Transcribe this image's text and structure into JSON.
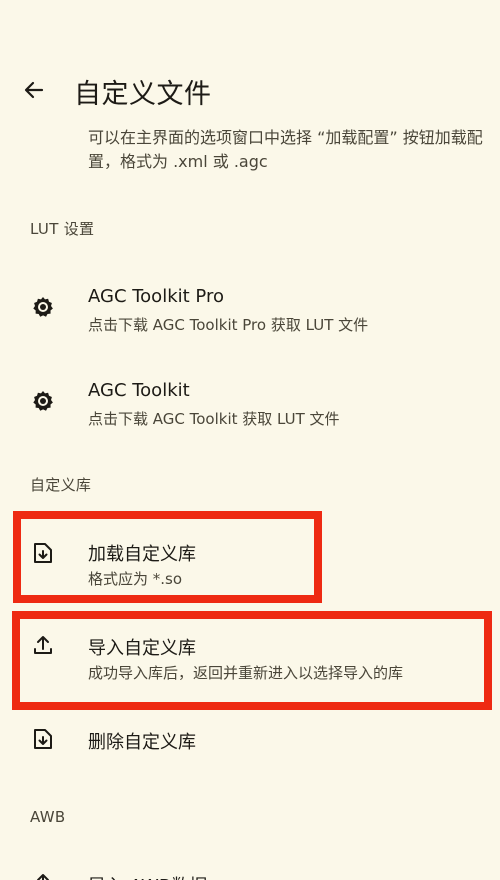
{
  "header": {
    "title": "自定义文件",
    "description": "可以在主界面的选项窗口中选择 “加载配置” 按钮加载配置，格式为 .xml 或 .agc"
  },
  "sections": {
    "lut": {
      "header": "LUT 设置",
      "items": [
        {
          "label": "AGC Toolkit Pro",
          "sub": "点击下载 AGC Toolkit Pro 获取 LUT 文件",
          "icon": "gear-icon"
        },
        {
          "label": "AGC Toolkit",
          "sub": "点击下载 AGC Toolkit 获取 LUT 文件",
          "icon": "gear-icon"
        }
      ]
    },
    "library": {
      "header": "自定义库",
      "items": [
        {
          "label": "加载自定义库",
          "sub": "格式应为 *.so",
          "icon": "file-download-icon"
        },
        {
          "label": "导入自定义库",
          "sub": "成功导入库后，返回并重新进入以选择导入的库",
          "icon": "upload-icon"
        },
        {
          "label": "删除自定义库",
          "icon": "file-download-icon"
        }
      ]
    },
    "awb": {
      "header": "AWB",
      "items": [
        {
          "label": "导入 AWB数据",
          "icon": "upload-icon"
        }
      ]
    }
  },
  "colors": {
    "background": "#fbf8e9",
    "highlight": "#ee2a12"
  }
}
